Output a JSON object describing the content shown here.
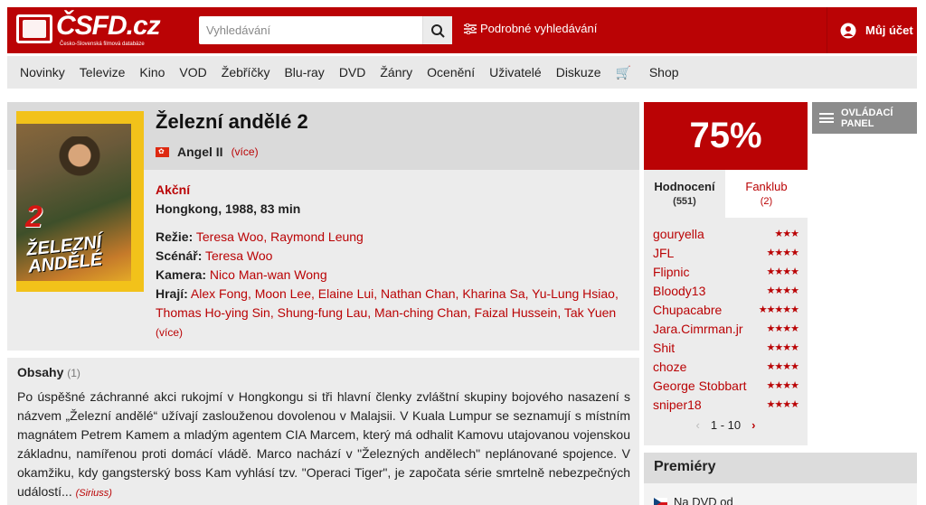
{
  "header": {
    "logo_text": "ČSFD.cz",
    "logo_tagline": "Česko-Slovenská filmová databáze",
    "search_placeholder": "Vyhledávání",
    "advanced_search": "Podrobné vyhledávání",
    "account": "Můj účet"
  },
  "nav": [
    "Novinky",
    "Televize",
    "Kino",
    "VOD",
    "Žebříčky",
    "Blu-ray",
    "DVD",
    "Žánry",
    "Ocenění",
    "Uživatelé",
    "Diskuze",
    "Shop"
  ],
  "film": {
    "title": "Železní andělé 2",
    "alt_title": "Angel II",
    "more": "(více)",
    "genre": "Akční",
    "origin": "Hongkong, 1988, 83 min",
    "director_label": "Režie:",
    "directors": "Teresa Woo, Raymond Leung",
    "writer_label": "Scénář:",
    "writers": "Teresa Woo",
    "camera_label": "Kamera:",
    "camera": "Nico Man-wan Wong",
    "cast_label": "Hrají:",
    "cast": "Alex Fong, Moon Lee, Elaine Lui, Nathan Chan, Kharina Sa, Yu-Lung Hsiao, Thomas Ho-ying Sin, Shung-fung Lau, Man-ching Chan, Faizal Hussein, Tak Yuen",
    "cast_more": "(více)",
    "poster_number": "2",
    "poster_title": "ŽELEZNÍ ANDĚLÉ"
  },
  "plot": {
    "heading": "Obsahy",
    "count": "(1)",
    "text": "Po úspěšné záchranné akci rukojmí v Hongkongu si tři hlavní členky zvláštní skupiny bojového nasazení s názvem „Železní andělé“ užívají zaslouženou dovolenou v Malajsii. V Kuala Lumpur se seznamují s místním magnátem Petrem Kamem a mladým agentem CIA Marcem, který má odhalit Kamovu utajovanou vojenskou základnu, namířenou proti domácí vládě. Marco nachází v \"Železných andělech\" neplánované spojence. V okamžiku, kdy gangsterský boss Kam vyhlásí tzv. \"Operaci Tiger\", je započata série smrtelně nebezpečných událostí...",
    "source": "(Siriuss)"
  },
  "rating": {
    "percent": "75%",
    "tab_ratings": "Hodnocení",
    "tab_ratings_count": "(551)",
    "tab_fanclub": "Fanklub",
    "tab_fanclub_count": "(2)",
    "users": [
      {
        "name": "gouryella",
        "stars": "★★★"
      },
      {
        "name": "JFL",
        "stars": "★★★★"
      },
      {
        "name": "Flipnic",
        "stars": "★★★★"
      },
      {
        "name": "Bloody13",
        "stars": "★★★★"
      },
      {
        "name": "Chupacabre",
        "stars": "★★★★★"
      },
      {
        "name": "Jara.Cimrman.jr",
        "stars": "★★★★"
      },
      {
        "name": "Shit",
        "stars": "★★★★"
      },
      {
        "name": "choze",
        "stars": "★★★★"
      },
      {
        "name": "George Stobbart",
        "stars": "★★★★"
      },
      {
        "name": "sniper18",
        "stars": "★★★★"
      }
    ],
    "pager": "1 - 10"
  },
  "control_panel": "OVLÁDACÍ PANEL",
  "premieres": {
    "heading": "Premiéry",
    "item": "Na DVD od"
  }
}
